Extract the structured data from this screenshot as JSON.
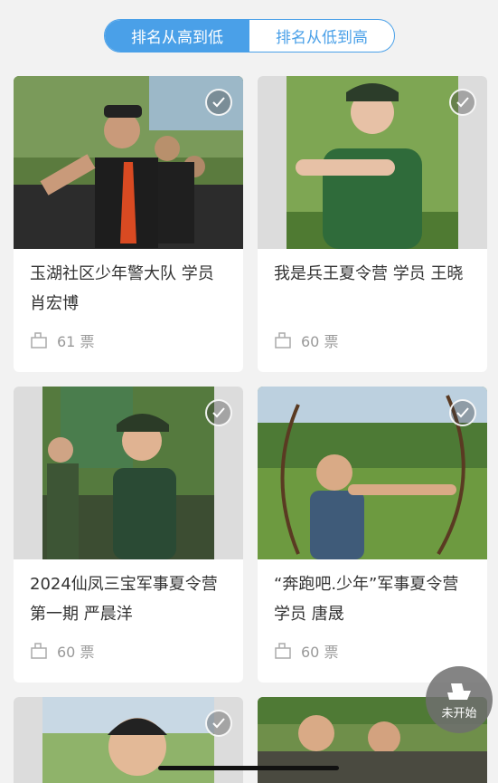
{
  "tabs": [
    {
      "label": "排名从高到低",
      "active": true
    },
    {
      "label": "排名从低到高",
      "active": false
    }
  ],
  "cards": [
    {
      "title": "玉湖社区少年警大队 学员 肖宏博",
      "votes": "61 票"
    },
    {
      "title": "我是兵王夏令营 学员 王晓",
      "votes": "60 票"
    },
    {
      "title": "2024仙凤三宝军事夏令营第一期 严晨洋",
      "votes": "60 票"
    },
    {
      "title": "“奔跑吧.少年”军事夏令营 学员 唐晟",
      "votes": "60 票"
    }
  ],
  "status_button": {
    "label": "未开始"
  },
  "colors": {
    "accent": "#4aa0e8"
  }
}
